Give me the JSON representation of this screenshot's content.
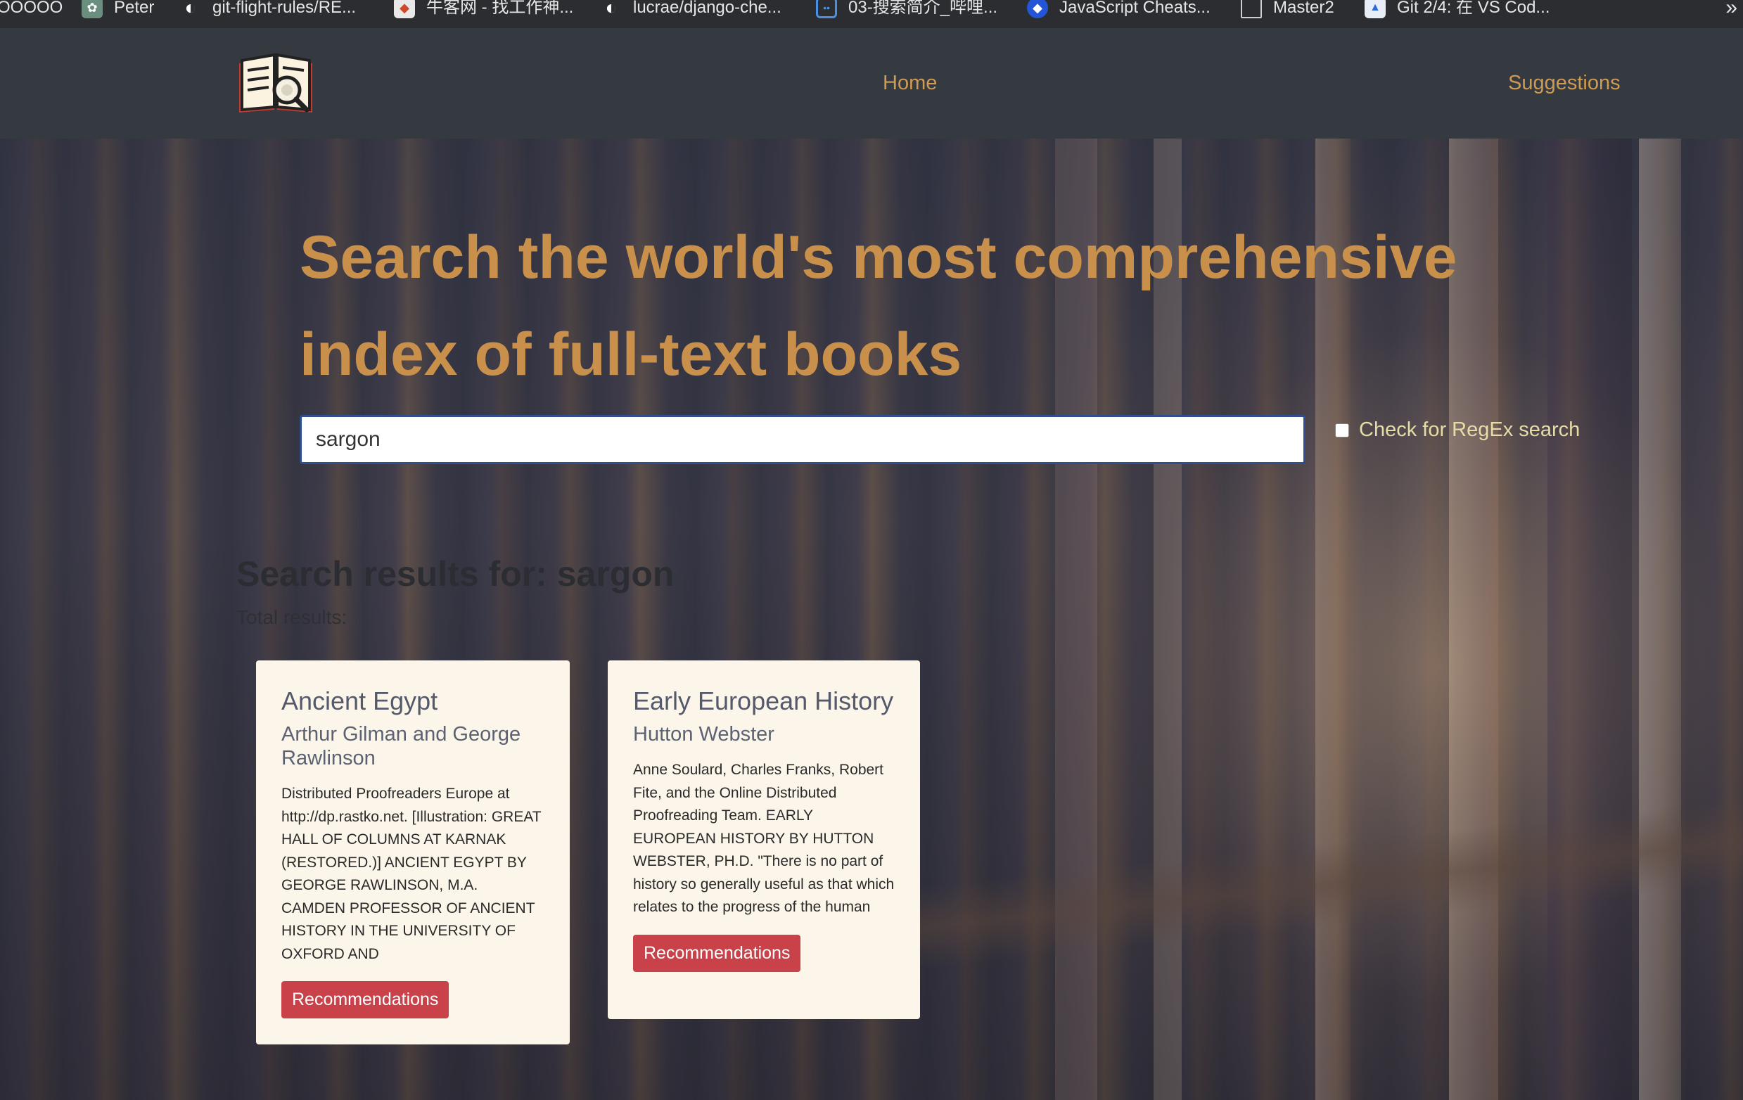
{
  "browser": {
    "bookmarks": [
      {
        "label": "OOOOO",
        "icon": "none"
      },
      {
        "label": "Peter",
        "icon": "openai-icon"
      },
      {
        "label": "git-flight-rules/RE...",
        "icon": "github-icon"
      },
      {
        "label": "牛客网 - 找工作神...",
        "icon": "nowcoder-icon"
      },
      {
        "label": "lucrae/django-che...",
        "icon": "github-icon"
      },
      {
        "label": "03-搜索简介_哔哩...",
        "icon": "bilibili-icon"
      },
      {
        "label": "JavaScript Cheats...",
        "icon": "diamond-icon"
      },
      {
        "label": "Master2",
        "icon": "window-icon"
      },
      {
        "label": "Git 2/4: 在 VS Cod...",
        "icon": "chart-icon"
      }
    ],
    "overflow": "»"
  },
  "nav": {
    "home": "Home",
    "suggestions": "Suggestions"
  },
  "hero": {
    "headline": "Search the world's most comprehensive index of full-text books"
  },
  "search": {
    "value": "sargon",
    "regex_label": "Check for RegEx search",
    "regex_checked": false
  },
  "results": {
    "title": "Search results for: sargon",
    "total": "Total results:",
    "items": [
      {
        "title": "Ancient Egypt",
        "author": "Arthur Gilman and George Rawlinson",
        "excerpt": "Distributed Proofreaders Europe at http://dp.rastko.net. [Illustration: GREAT HALL OF COLUMNS AT KARNAK (RESTORED.)] ANCIENT EGYPT BY GEORGE RAWLINSON, M.A. CAMDEN PROFESSOR OF ANCIENT HISTORY IN THE UNIVERSITY OF OXFORD AND",
        "button": "Recommendations"
      },
      {
        "title": "Early European History",
        "author": "Hutton Webster",
        "excerpt": "Anne Soulard, Charles Franks, Robert Fite, and the Online Distributed Proofreading Team. EARLY EUROPEAN HISTORY BY HUTTON WEBSTER, PH.D. \"There is no part of history so generally useful as that which relates to the progress of the human mind, the",
        "button": "Recommendations"
      }
    ]
  }
}
